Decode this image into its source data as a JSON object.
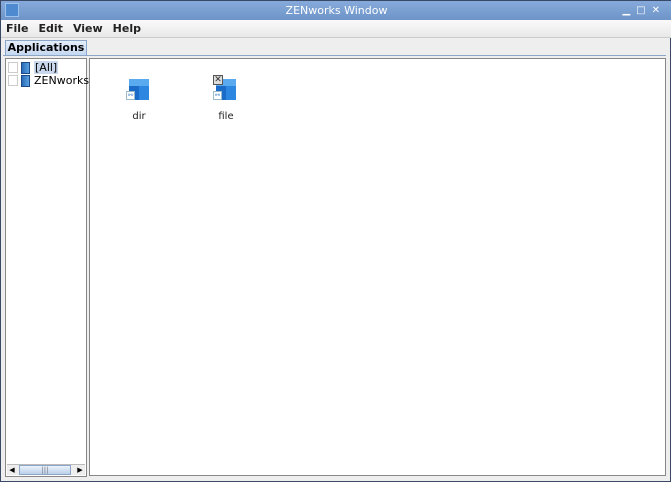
{
  "window": {
    "title": "ZENworks Window"
  },
  "menu": [
    "File",
    "Edit",
    "View",
    "Help"
  ],
  "tabs": [
    {
      "label": "Applications"
    }
  ],
  "tree": [
    {
      "label": "[All]",
      "selected": true
    },
    {
      "label": "ZENworks"
    }
  ],
  "apps": [
    {
      "label": "dir",
      "icon": "application-cube-icon"
    },
    {
      "label": "file",
      "icon": "application-cube-icon",
      "status": "disabled"
    }
  ]
}
